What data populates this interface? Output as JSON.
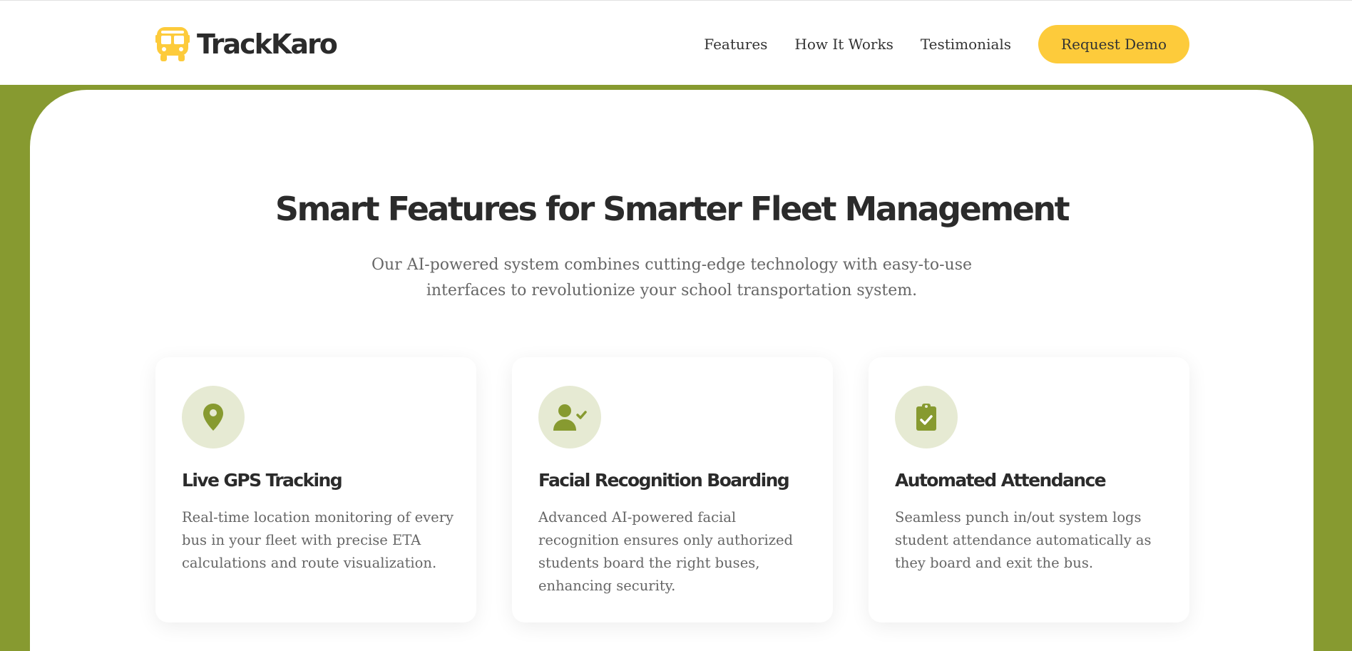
{
  "brand": {
    "name": "TrackKaro",
    "logo_icon": "bus-icon",
    "logo_color": "#fdcb3b"
  },
  "nav": {
    "links": [
      "Features",
      "How It Works",
      "Testimonials"
    ],
    "cta_label": "Request Demo",
    "cta_color": "#fdcb3b"
  },
  "theme": {
    "accent_green": "#879a30",
    "icon_bg": "#e6ead3",
    "heading_color": "#2b2b2b",
    "body_text_color": "#666666"
  },
  "features_section": {
    "title": "Smart Features for Smarter Fleet Management",
    "subtitle_lines": [
      "Our AI-powered system combines cutting-edge technology with easy-to-use",
      "interfaces to revolutionize your school transportation system."
    ],
    "cards": [
      {
        "icon": "map-pin-icon",
        "title": "Live GPS Tracking",
        "description_lines": [
          "Real-time location monitoring of every",
          "bus in your fleet with precise ETA",
          "calculations and route visualization."
        ]
      },
      {
        "icon": "user-check-icon",
        "title": "Facial Recognition Boarding",
        "description_lines": [
          "Advanced AI-powered facial",
          "recognition ensures only authorized",
          "students board the right buses,",
          "enhancing security."
        ]
      },
      {
        "icon": "clipboard-check-icon",
        "title": "Automated Attendance",
        "description_lines": [
          "Seamless punch in/out system logs",
          "student attendance automatically as",
          "they board and exit the bus."
        ]
      }
    ]
  }
}
